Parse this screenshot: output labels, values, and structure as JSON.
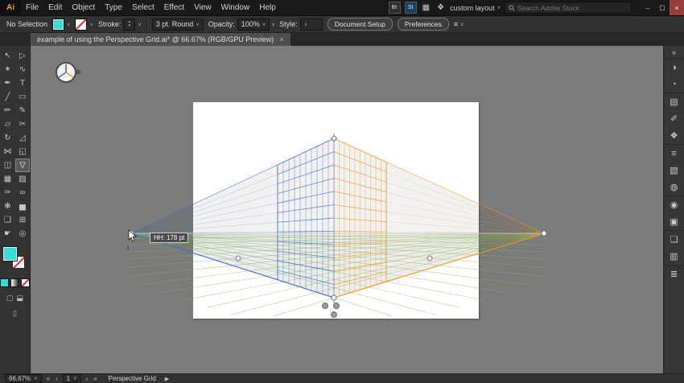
{
  "menu": {
    "app_label": "Ai",
    "items": [
      {
        "name": "menu-file",
        "label": "File"
      },
      {
        "name": "menu-edit",
        "label": "Edit"
      },
      {
        "name": "menu-object",
        "label": "Object"
      },
      {
        "name": "menu-type",
        "label": "Type"
      },
      {
        "name": "menu-select",
        "label": "Select"
      },
      {
        "name": "menu-effect",
        "label": "Effect"
      },
      {
        "name": "menu-view",
        "label": "View"
      },
      {
        "name": "menu-window",
        "label": "Window"
      },
      {
        "name": "menu-help",
        "label": "Help"
      }
    ],
    "bridge_label": "Br",
    "stock_label": "St",
    "workspace_label": "custom layout",
    "search_placeholder": "Search Adobe Stock",
    "window": {
      "minimize": "–",
      "restore": "◻",
      "close": "×"
    }
  },
  "controls": {
    "selection_label": "No Selection",
    "stroke_label": "Stroke:",
    "brush_name": "3 pt. Round",
    "opacity_label": "Opacity:",
    "opacity_value": "100%",
    "style_label": "Style:",
    "doc_setup_label": "Document Setup",
    "preferences_label": "Preferences"
  },
  "tab": {
    "title": "example of using the Perspective Grid.ai* @ 66.67% (RGB/GPU Preview)",
    "close_glyph": "×"
  },
  "tools": [
    {
      "name": "selection-tool",
      "glyph": "↖"
    },
    {
      "name": "direct-selection-tool",
      "glyph": "▷"
    },
    {
      "name": "magic-wand-tool",
      "glyph": "✶"
    },
    {
      "name": "lasso-tool",
      "glyph": "∿"
    },
    {
      "name": "pen-tool",
      "glyph": "✒"
    },
    {
      "name": "type-tool",
      "glyph": "T"
    },
    {
      "name": "line-segment-tool",
      "glyph": "╱"
    },
    {
      "name": "rectangle-tool",
      "glyph": "▭"
    },
    {
      "name": "paintbrush-tool",
      "glyph": "✏"
    },
    {
      "name": "pencil-tool",
      "glyph": "✎"
    },
    {
      "name": "eraser-tool",
      "glyph": "▱"
    },
    {
      "name": "scissors-tool",
      "glyph": "✂"
    },
    {
      "name": "rotate-tool",
      "glyph": "↻"
    },
    {
      "name": "scale-tool",
      "glyph": "◿"
    },
    {
      "name": "width-tool",
      "glyph": "⋈"
    },
    {
      "name": "free-transform-tool",
      "glyph": "◱"
    },
    {
      "name": "shape-builder-tool",
      "glyph": "◫"
    },
    {
      "name": "perspective-grid-tool",
      "glyph": "▽",
      "active": true
    },
    {
      "name": "mesh-tool",
      "glyph": "▦"
    },
    {
      "name": "gradient-tool",
      "glyph": "▨"
    },
    {
      "name": "eyedropper-tool",
      "glyph": "✑"
    },
    {
      "name": "blend-tool",
      "glyph": "∞"
    },
    {
      "name": "symbol-sprayer-tool",
      "glyph": "❋"
    },
    {
      "name": "column-graph-tool",
      "glyph": "▅"
    },
    {
      "name": "artboard-tool",
      "glyph": "❏"
    },
    {
      "name": "slice-tool",
      "glyph": "⊞"
    },
    {
      "name": "hand-tool",
      "glyph": "☛"
    },
    {
      "name": "zoom-tool",
      "glyph": "◎"
    }
  ],
  "dock": {
    "collapse_glyph": "«",
    "panels": [
      {
        "name": "color-panel",
        "glyph": "◑"
      },
      {
        "name": "color-guide-panel",
        "glyph": "◔"
      },
      {
        "name": "swatches-panel",
        "glyph": "▤",
        "grp": true
      },
      {
        "name": "brushes-panel",
        "glyph": "✐"
      },
      {
        "name": "symbols-panel",
        "glyph": "❖"
      },
      {
        "name": "stroke-panel",
        "glyph": "≡",
        "grp": true
      },
      {
        "name": "gradient-panel",
        "glyph": "▧"
      },
      {
        "name": "transparency-panel",
        "glyph": "◍"
      },
      {
        "name": "appearance-panel",
        "glyph": "◉",
        "grp": true
      },
      {
        "name": "graphic-styles-panel",
        "glyph": "▣"
      },
      {
        "name": "layers-panel",
        "glyph": "❏",
        "grp": true
      },
      {
        "name": "artboards-panel",
        "glyph": "▥"
      },
      {
        "name": "libraries-panel",
        "glyph": "≣",
        "grp": true
      }
    ]
  },
  "canvas": {
    "tooltip_text": "HH: 178 pt"
  },
  "statusbar": {
    "zoom": "66.67%",
    "artboard_value": "1",
    "tool_label": "Perspective Grid"
  },
  "icons": {
    "chevron_down": "∨",
    "stepper_up": "▴",
    "stepper_down": "▾",
    "more_chevron": "›",
    "align_icon": "≡",
    "workspace_icon": "▦",
    "apps_icon": "❖",
    "nav_first": "«",
    "nav_prev": "‹",
    "nav_next": "›",
    "nav_last": "»",
    "play": "▶",
    "draw_normal": "▢",
    "draw_behind": "⬓",
    "screen_mode": "▯"
  },
  "colors": {
    "accent_cyan": "#35dcd8",
    "grid_blue": "#4472c8",
    "grid_orange": "#ef9b28",
    "grid_green": "#84b458",
    "horizon_gray": "#c9c9c9"
  }
}
